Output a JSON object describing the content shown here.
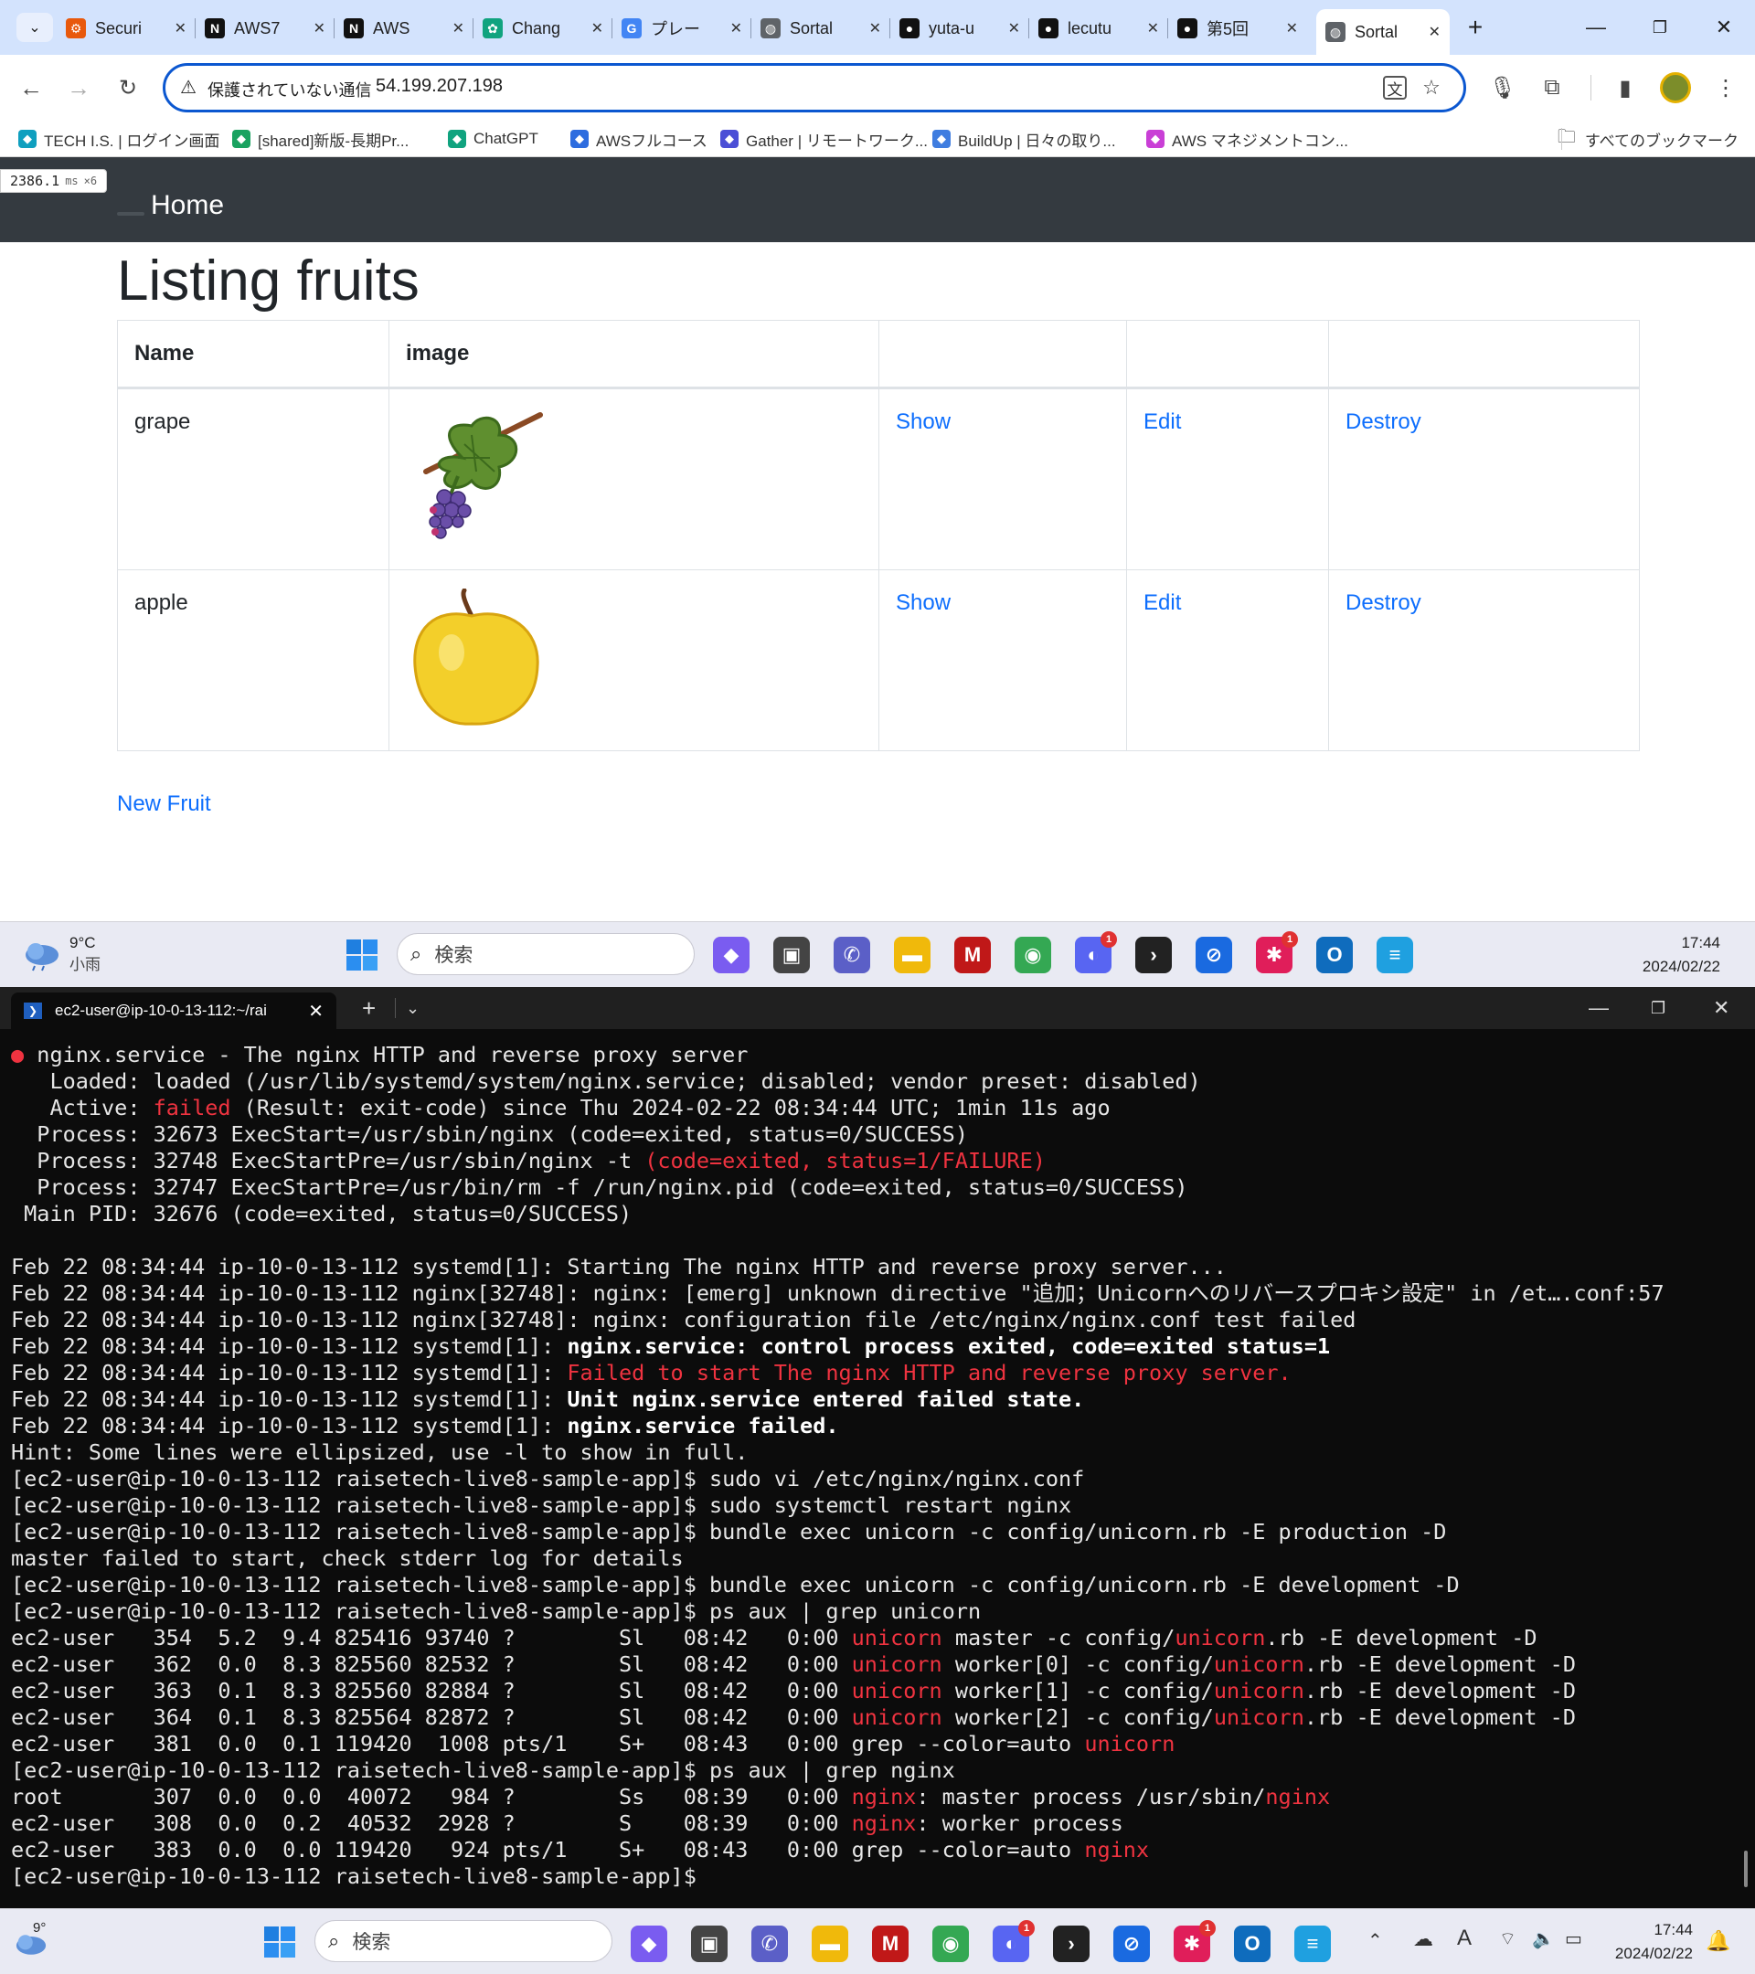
{
  "browser": {
    "tabs": [
      {
        "title": "Securi",
        "icon": "aws-security-icon",
        "color": "#e8590c"
      },
      {
        "title": "AWS7",
        "icon": "notion-icon",
        "color": "#111111"
      },
      {
        "title": "AWS",
        "icon": "notion-icon",
        "color": "#111111"
      },
      {
        "title": "Chang",
        "icon": "chatgpt-icon",
        "color": "#10a37f"
      },
      {
        "title": "プレー",
        "icon": "google-icon",
        "color": "#4285f4"
      },
      {
        "title": "Sortal",
        "icon": "globe-icon",
        "color": "#5f6368"
      },
      {
        "title": "yuta-u",
        "icon": "github-icon",
        "color": "#111111"
      },
      {
        "title": "lecutu",
        "icon": "github-icon",
        "color": "#111111"
      },
      {
        "title": "第5回",
        "icon": "github-icon",
        "color": "#111111"
      },
      {
        "title": "Sortal",
        "icon": "globe-icon",
        "color": "#5f6368",
        "active": true
      }
    ],
    "address": {
      "security_label": "保護されていない通信",
      "url": "54.199.207.198"
    },
    "bookmarks": [
      {
        "label": "TECH I.S. | ログイン画面",
        "color": "#0f9fbf"
      },
      {
        "label": "[shared]新版-長期Pr...",
        "color": "#1aa260"
      },
      {
        "label": "ChatGPT",
        "color": "#10a37f"
      },
      {
        "label": "AWSフルコース",
        "color": "#2d6cdf"
      },
      {
        "label": "Gather | リモートワーク...",
        "color": "#4b4fd6"
      },
      {
        "label": "BuildUp | 日々の取り...",
        "color": "#3f7de0"
      },
      {
        "label": "AWS マネジメントコン...",
        "color": "#c93fd6"
      }
    ],
    "all_bookmarks": "すべてのブックマーク"
  },
  "page": {
    "perf": {
      "value": "2386.1",
      "unit": "ms",
      "multiplier": "×6"
    },
    "nav_home": "Home",
    "title": "Listing fruits",
    "table": {
      "headers": [
        "Name",
        "image",
        "",
        "",
        ""
      ],
      "rows": [
        {
          "name": "grape",
          "image": "grape-image",
          "show": "Show",
          "edit": "Edit",
          "destroy": "Destroy"
        },
        {
          "name": "apple",
          "image": "apple-image",
          "show": "Show",
          "edit": "Edit",
          "destroy": "Destroy"
        }
      ]
    },
    "new_link": "New Fruit"
  },
  "taskbar_top": {
    "weather_temp": "9°C",
    "weather_desc": "小雨",
    "search_placeholder": "検索",
    "time": "17:44",
    "date": "2024/02/22"
  },
  "terminal": {
    "tab_title": "ec2-user@ip-10-0-13-112:~/rai",
    "lines": [
      [
        {
          "t": "● ",
          "c": "r"
        },
        {
          "t": "nginx.service - The nginx HTTP and reverse proxy server"
        }
      ],
      [
        {
          "t": "   Loaded: loaded (/usr/lib/systemd/system/nginx.service; disabled; vendor preset: disabled)"
        }
      ],
      [
        {
          "t": "   Active: "
        },
        {
          "t": "failed",
          "c": "r"
        },
        {
          "t": " (Result: exit-code) since Thu 2024-02-22 08:34:44 UTC; 1min 11s ago"
        }
      ],
      [
        {
          "t": "  Process: 32673 ExecStart=/usr/sbin/nginx (code=exited, status=0/SUCCESS)"
        }
      ],
      [
        {
          "t": "  Process: 32748 ExecStartPre=/usr/sbin/nginx -t "
        },
        {
          "t": "(code=exited, status=1/FAILURE)",
          "c": "r"
        }
      ],
      [
        {
          "t": "  Process: 32747 ExecStartPre=/usr/bin/rm -f /run/nginx.pid (code=exited, status=0/SUCCESS)"
        }
      ],
      [
        {
          "t": " Main PID: 32676 (code=exited, status=0/SUCCESS)"
        }
      ],
      [
        {
          "t": ""
        }
      ],
      [
        {
          "t": "Feb 22 08:34:44 ip-10-0-13-112 systemd[1]: Starting The nginx HTTP and reverse proxy server..."
        }
      ],
      [
        {
          "t": "Feb 22 08:34:44 ip-10-0-13-112 nginx[32748]: nginx: [emerg] unknown directive \"追加；Unicornへのリバースプロキシ設定\" in /et….conf:57"
        }
      ],
      [
        {
          "t": "Feb 22 08:34:44 ip-10-0-13-112 nginx[32748]: nginx: configuration file /etc/nginx/nginx.conf test failed"
        }
      ],
      [
        {
          "t": "Feb 22 08:34:44 ip-10-0-13-112 systemd[1]: "
        },
        {
          "t": "nginx.service: control process exited, code=exited status=1",
          "c": "b"
        }
      ],
      [
        {
          "t": "Feb 22 08:34:44 ip-10-0-13-112 systemd[1]: "
        },
        {
          "t": "Failed to start The nginx HTTP and reverse proxy server.",
          "c": "r"
        }
      ],
      [
        {
          "t": "Feb 22 08:34:44 ip-10-0-13-112 systemd[1]: "
        },
        {
          "t": "Unit nginx.service entered failed state.",
          "c": "b"
        }
      ],
      [
        {
          "t": "Feb 22 08:34:44 ip-10-0-13-112 systemd[1]: "
        },
        {
          "t": "nginx.service failed.",
          "c": "b"
        }
      ],
      [
        {
          "t": "Hint: Some lines were ellipsized, use -l to show in full."
        }
      ],
      [
        {
          "t": "[ec2-user@ip-10-0-13-112 raisetech-live8-sample-app]$ sudo vi /etc/nginx/nginx.conf"
        }
      ],
      [
        {
          "t": "[ec2-user@ip-10-0-13-112 raisetech-live8-sample-app]$ sudo systemctl restart nginx"
        }
      ],
      [
        {
          "t": "[ec2-user@ip-10-0-13-112 raisetech-live8-sample-app]$ bundle exec unicorn -c config/unicorn.rb -E production -D"
        }
      ],
      [
        {
          "t": "master failed to start, check stderr log for details"
        }
      ],
      [
        {
          "t": "[ec2-user@ip-10-0-13-112 raisetech-live8-sample-app]$ bundle exec unicorn -c config/unicorn.rb -E development -D"
        }
      ],
      [
        {
          "t": "[ec2-user@ip-10-0-13-112 raisetech-live8-sample-app]$ ps aux | grep unicorn"
        }
      ],
      [
        {
          "t": "ec2-user   354  5.2  9.4 825416 93740 ?        Sl   08:42   0:00 "
        },
        {
          "t": "unicorn",
          "c": "r"
        },
        {
          "t": " master -c config/"
        },
        {
          "t": "unicorn",
          "c": "r"
        },
        {
          "t": ".rb -E development -D"
        }
      ],
      [
        {
          "t": "ec2-user   362  0.0  8.3 825560 82532 ?        Sl   08:42   0:00 "
        },
        {
          "t": "unicorn",
          "c": "r"
        },
        {
          "t": " worker[0] -c config/"
        },
        {
          "t": "unicorn",
          "c": "r"
        },
        {
          "t": ".rb -E development -D"
        }
      ],
      [
        {
          "t": "ec2-user   363  0.1  8.3 825560 82884 ?        Sl   08:42   0:00 "
        },
        {
          "t": "unicorn",
          "c": "r"
        },
        {
          "t": " worker[1] -c config/"
        },
        {
          "t": "unicorn",
          "c": "r"
        },
        {
          "t": ".rb -E development -D"
        }
      ],
      [
        {
          "t": "ec2-user   364  0.1  8.3 825564 82872 ?        Sl   08:42   0:00 "
        },
        {
          "t": "unicorn",
          "c": "r"
        },
        {
          "t": " worker[2] -c config/"
        },
        {
          "t": "unicorn",
          "c": "r"
        },
        {
          "t": ".rb -E development -D"
        }
      ],
      [
        {
          "t": "ec2-user   381  0.0  0.1 119420  1008 pts/1    S+   08:43   0:00 grep --color=auto "
        },
        {
          "t": "unicorn",
          "c": "r"
        }
      ],
      [
        {
          "t": "[ec2-user@ip-10-0-13-112 raisetech-live8-sample-app]$ ps aux | grep nginx"
        }
      ],
      [
        {
          "t": "root       307  0.0  0.0  40072   984 ?        Ss   08:39   0:00 "
        },
        {
          "t": "nginx",
          "c": "r"
        },
        {
          "t": ": master process /usr/sbin/"
        },
        {
          "t": "nginx",
          "c": "r"
        }
      ],
      [
        {
          "t": "ec2-user   308  0.0  0.2  40532  2928 ?        S    08:39   0:00 "
        },
        {
          "t": "nginx",
          "c": "r"
        },
        {
          "t": ": worker process"
        }
      ],
      [
        {
          "t": "ec2-user   383  0.0  0.0 119420   924 pts/1    S+   08:43   0:00 grep --color=auto "
        },
        {
          "t": "nginx",
          "c": "r"
        }
      ],
      [
        {
          "t": "[ec2-user@ip-10-0-13-112 raisetech-live8-sample-app]$ "
        }
      ]
    ]
  },
  "taskbar_bottom": {
    "weather_temp": "9°",
    "search_placeholder": "検索",
    "time": "17:44",
    "date": "2024/02/22"
  },
  "colors": {
    "accent": "#0b57d0",
    "link": "#0d6efd",
    "navbar": "#343a40",
    "terminal_red": "#ef3340"
  }
}
